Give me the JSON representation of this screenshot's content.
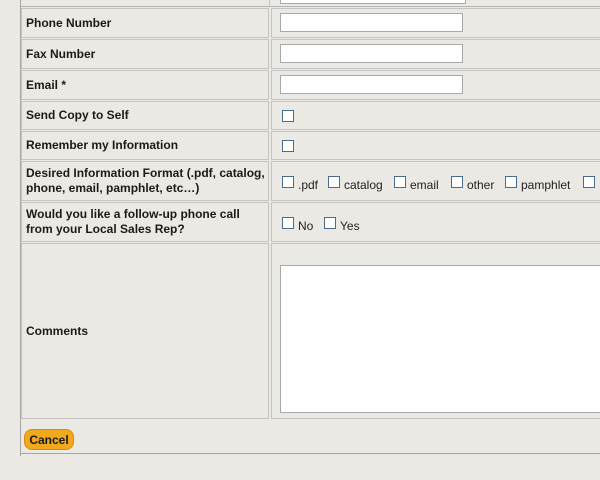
{
  "form": {
    "phone_label": "Phone Number",
    "fax_label": "Fax Number",
    "email_label": "Email *",
    "send_copy_label": "Send Copy to Self",
    "remember_label": "Remember my Information",
    "format_label": "Desired Information Format (.pdf, catalog, phone, email, pamphlet, etc…)",
    "format_options": [
      ".pdf",
      "catalog",
      "email",
      "other",
      "pamphlet"
    ],
    "followup_label": "Would you like a follow-up phone call from your Local Sales Rep?",
    "followup_options": [
      "No",
      "Yes"
    ],
    "comments_label": "Comments",
    "phone_value": "",
    "fax_value": "",
    "email_value": "",
    "comments_value": ""
  },
  "actions": {
    "cancel_label": "Cancel"
  },
  "colors": {
    "background": "#ebe9e4",
    "button": "#f0a81c",
    "checkbox_border": "#4a6a8f"
  }
}
